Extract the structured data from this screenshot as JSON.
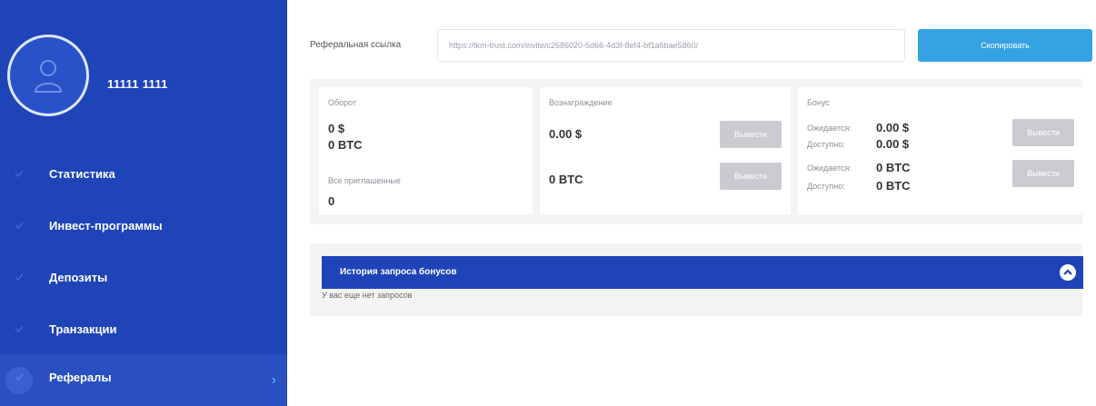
{
  "user": {
    "name": "11111 1111"
  },
  "nav": {
    "items": [
      {
        "label": "Статистика"
      },
      {
        "label": "Инвест-программы"
      },
      {
        "label": "Депозиты"
      },
      {
        "label": "Транзакции"
      },
      {
        "label": "Рефералы"
      }
    ]
  },
  "referral": {
    "label": "Реферальная ссылка",
    "link": "https://tkm-trust.com/invite/c2686020-5d66-4d3f-8ef4-bf1a6bae5860/",
    "copy_label": "Скопировать"
  },
  "turnover": {
    "title": "Оборот",
    "usd": "0 $",
    "btc": "0 BTC",
    "invited_label": "Все приглашенные",
    "invited_value": "0"
  },
  "reward": {
    "title": "Вознаграждение",
    "usd": "0.00 $",
    "btc": "0 BTC",
    "withdraw_label": "Вывести"
  },
  "bonus": {
    "title": "Бонус",
    "expected_label": "Ожидается:",
    "available_label": "Доступно:",
    "usd_expected": "0.00 $",
    "usd_available": "0.00 $",
    "btc_expected": "0 BTC",
    "btc_available": "0 BTC",
    "withdraw_label": "Вывести"
  },
  "history": {
    "title": "История запроса бонусов",
    "empty": "У вас еще нет запросов"
  }
}
